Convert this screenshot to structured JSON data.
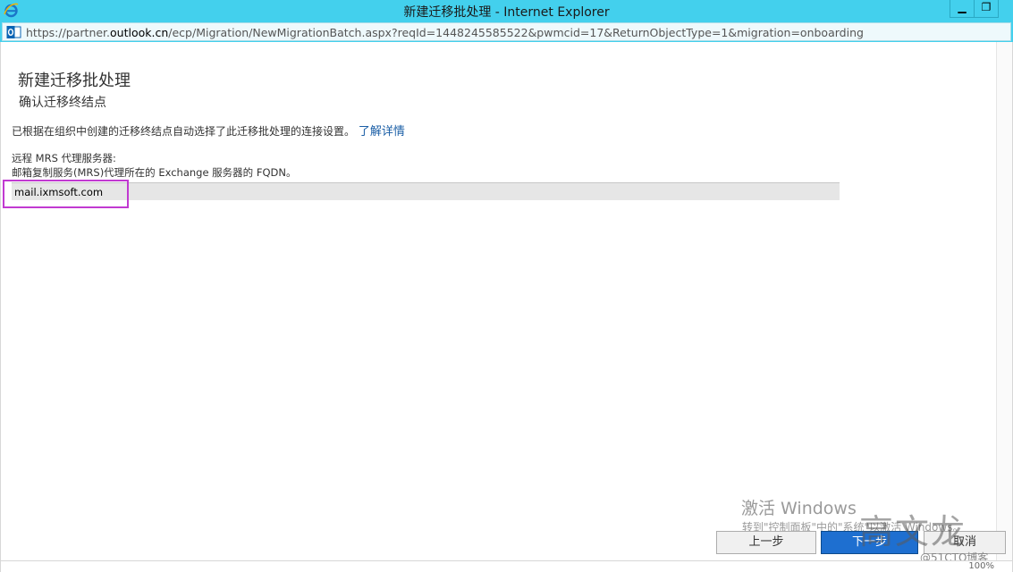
{
  "window": {
    "title": "新建迁移批处理 - Internet Explorer",
    "minimize_glyph": "▁",
    "restore_glyph": "❐"
  },
  "address": {
    "url_prefix": "https://partner.",
    "url_host": "outlook.cn",
    "url_path": "/ecp/Migration/NewMigrationBatch.aspx?reqId=1448245585522&pwmcid=17&ReturnObjectType=1&migration=onboarding"
  },
  "page": {
    "title": "新建迁移批处理",
    "subtitle": "确认迁移终结点",
    "description": "已根据在组织中创建的迁移终结点自动选择了此迁移批处理的连接设置。",
    "learn_more": "了解详情",
    "mrs_label": "远程 MRS 代理服务器:",
    "mrs_hint": "邮箱复制服务(MRS)代理所在的 Exchange 服务器的 FQDN。",
    "mrs_value": "mail.ixmsoft.com"
  },
  "buttons": {
    "back": "上一步",
    "next": "下一步",
    "cancel": "取消"
  },
  "watermark": {
    "activate_title": "激活 Windows",
    "activate_sub": "转到\"控制面板\"中的\"系统\"以激活 Windows。",
    "logo": "高文龙",
    "blog": "@51CTO博客"
  },
  "status": {
    "zoom": "100%"
  },
  "colors": {
    "titlebar": "#43d0ed",
    "highlight": "#c13ad1",
    "primary_button": "#1e6fd0",
    "link": "#1a5ea6"
  }
}
